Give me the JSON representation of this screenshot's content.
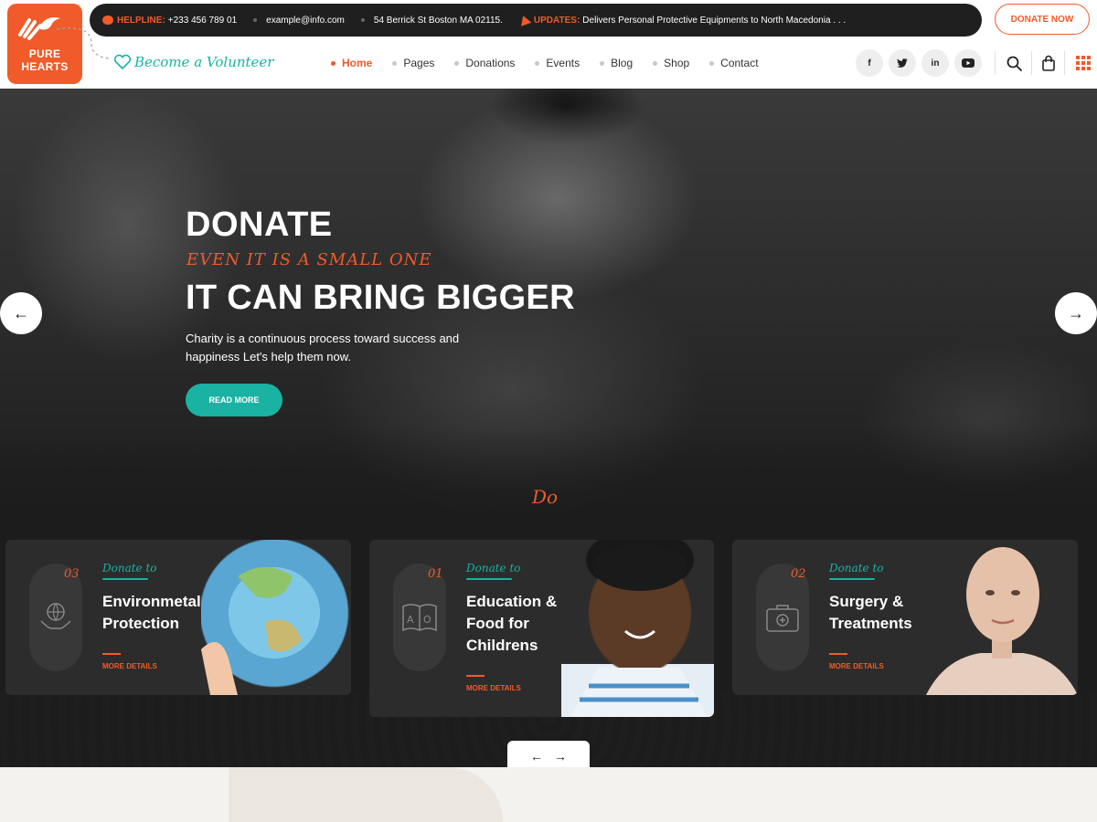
{
  "logo": {
    "line1": "PURE",
    "line2": "HEARTS"
  },
  "topbar": {
    "helpline_label": "HELPLINE:",
    "helpline_value": "+233 456 789 01",
    "email": "example@info.com",
    "address": "54 Berrick St Boston MA 02115.",
    "updates_label": "UPDATES:",
    "updates_text": "Delivers Personal Protective Equipments to North Macedonia . . ."
  },
  "donate_now": "DONATE NOW",
  "volunteer": "Become a Volunteer",
  "nav": [
    {
      "label": "Home",
      "active": true
    },
    {
      "label": "Pages"
    },
    {
      "label": "Donations"
    },
    {
      "label": "Events"
    },
    {
      "label": "Blog"
    },
    {
      "label": "Shop"
    },
    {
      "label": "Contact"
    }
  ],
  "socials": {
    "facebook": "f",
    "linkedin": "in"
  },
  "hero": {
    "title": "DONATE",
    "subtitle": "EVEN IT IS A SMALL ONE",
    "title2": "IT CAN BRING BIGGER",
    "description": "Charity is a continuous process toward success and happiness Let's help them now.",
    "button": "READ MORE",
    "prev_arrow": "←",
    "next_arrow": "→",
    "section_word": "Do"
  },
  "cards": [
    {
      "number": "03",
      "eyebrow": "Donate to",
      "title": "Environmetal Protection",
      "more": "MORE DETAILS",
      "icon": "globe-hands-icon"
    },
    {
      "number": "01",
      "eyebrow": "Donate to",
      "title": "Education & Food for Childrens",
      "more": "MORE DETAILS",
      "icon": "book-icon"
    },
    {
      "number": "02",
      "eyebrow": "Donate to",
      "title": "Surgery & Treatments",
      "more": "MORE DETAILS",
      "icon": "medical-kit-icon"
    }
  ],
  "carousel": {
    "prev": "←",
    "next": "→"
  },
  "colors": {
    "accent": "#f15a29",
    "teal": "#17b3a3",
    "dark": "#1f1f1f"
  }
}
